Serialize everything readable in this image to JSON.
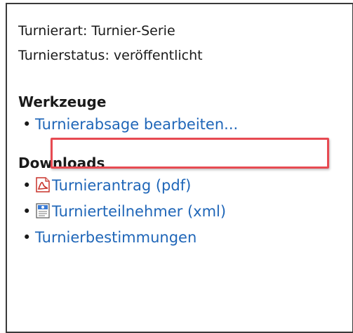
{
  "info": {
    "type_line": "Turnierart: Turnier-Serie",
    "status_line": "Turnierstatus: veröffentlicht"
  },
  "tools": {
    "heading": "Werkzeuge",
    "items": [
      {
        "label": "Turnierabsage bearbeiten..."
      }
    ]
  },
  "downloads": {
    "heading": "Downloads",
    "items": [
      {
        "label": "Turnierantrag (pdf)",
        "icon": "pdf-icon"
      },
      {
        "label": "Turnierteilnehmer (xml)",
        "icon": "xml-file-icon"
      },
      {
        "label": "Turnierbestimmungen",
        "icon": ""
      }
    ]
  },
  "colors": {
    "link": "#1f66b8",
    "highlight": "#e74a52"
  }
}
